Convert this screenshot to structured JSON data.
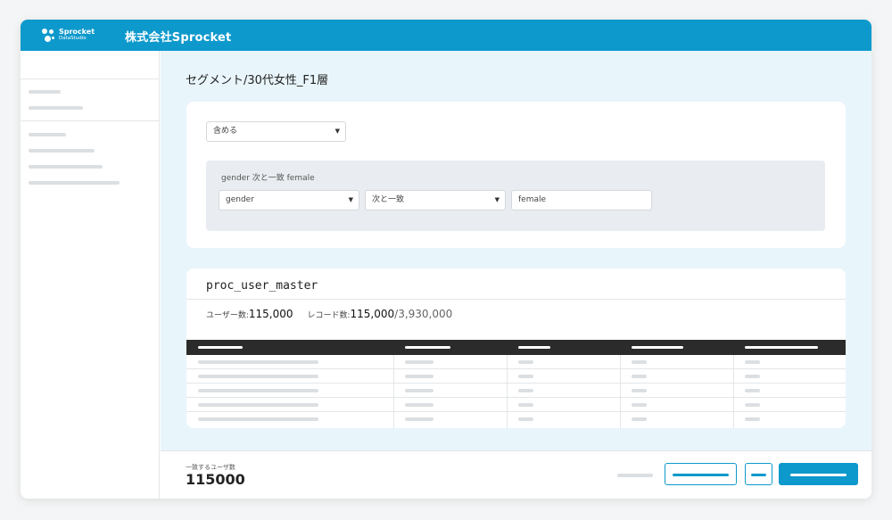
{
  "header": {
    "logo_name": "Sprocket",
    "logo_sub": "DataStudio",
    "company": "株式会社Sprocket",
    "color": "#0e99cc"
  },
  "page": {
    "title": "セグメント/30代女性_F1層"
  },
  "filter": {
    "mode_select": "含める",
    "condition_label": "gender 次と一致 female",
    "field_select": "gender",
    "operator_select": "次と一致",
    "value": "female"
  },
  "table_card": {
    "title": "proc_user_master",
    "users_label": "ユーザー数:",
    "users_value": "115,000",
    "records_label": "レコード数:",
    "records_value": "115,000",
    "records_total": "/3,930,000"
  },
  "footer": {
    "match_label": "一致するユーザ数",
    "match_value": "115000"
  },
  "icons": {
    "caret": "▼"
  }
}
